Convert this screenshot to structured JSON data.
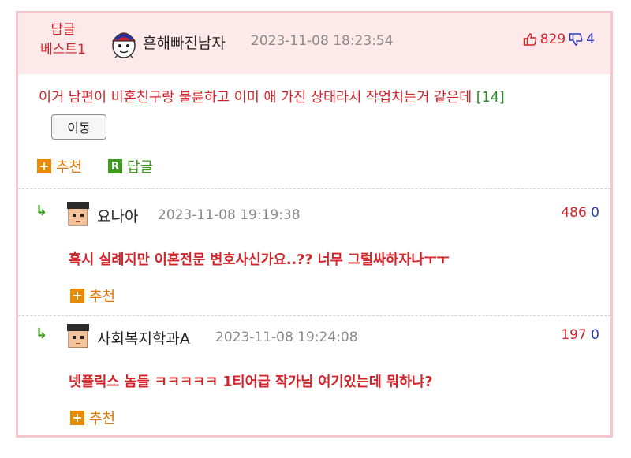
{
  "main_comment": {
    "badge_line1": "답글",
    "badge_line2": "베스트1",
    "author": "흔해빠진남자",
    "date": "2023-11-08 18:23:54",
    "upvotes": "829",
    "downvotes": "4",
    "text": "이거 남편이 비혼친구랑 불륜하고 이미 애 가진 상태라서 작업치는거 같은데",
    "reply_count": "[14]",
    "move_label": "이동",
    "recommend_label": "추천",
    "reply_label": "답글"
  },
  "replies": [
    {
      "author": "요나아",
      "date": "2023-11-08 19:19:38",
      "upvotes": "486",
      "downvotes": "0",
      "text": "혹시 실례지만 이혼전문 변호사신가요..?? 너무 그럴싸하자나ㅜㅜ",
      "recommend_label": "추천"
    },
    {
      "author": "사회복지학과A",
      "date": "2023-11-08 19:24:08",
      "upvotes": "197",
      "downvotes": "0",
      "text": "넷플릭스 놈들 ㅋㅋㅋㅋㅋ 1티어급 작가님 여기있는데 뭐하냐?",
      "recommend_label": "추천"
    }
  ],
  "colors": {
    "accent_red": "#d2242a",
    "down_blue": "#2f3bb5",
    "header_pink": "#fde9ea",
    "orange": "#e07400",
    "green": "#3f9a1e"
  }
}
